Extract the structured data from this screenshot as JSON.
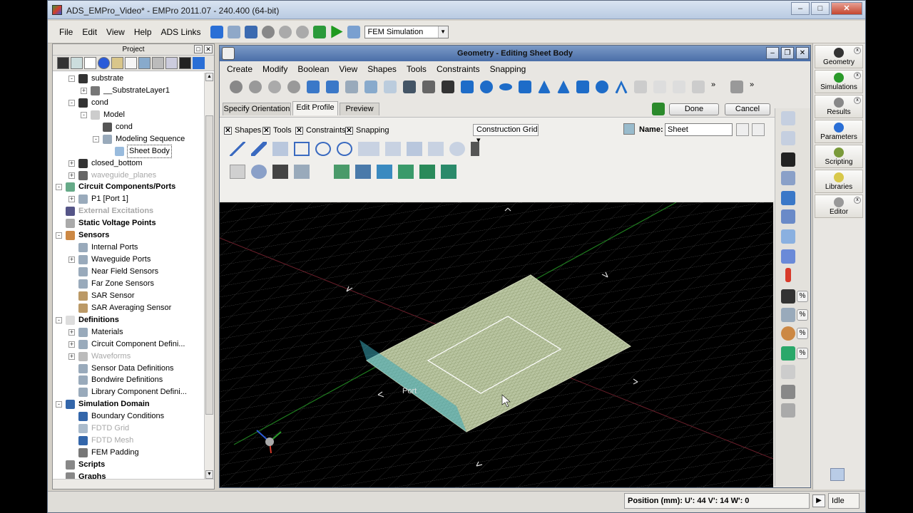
{
  "window": {
    "title": "ADS_EMPro_Video* - EMPro 2011.07 - 240.400 (64-bit)"
  },
  "menubar": {
    "items": [
      "File",
      "Edit",
      "View",
      "Help",
      "ADS Links"
    ],
    "simulation_select": "FEM Simulation"
  },
  "project": {
    "title": "Project",
    "tree": [
      {
        "label": "substrate",
        "indent": 0,
        "exp": "-",
        "style": "normal",
        "icon": "#333"
      },
      {
        "label": "__SubstrateLayer1",
        "indent": 1,
        "exp": "+",
        "style": "normal",
        "icon": "#777"
      },
      {
        "label": "cond",
        "indent": 0,
        "exp": "-",
        "style": "normal",
        "icon": "#333"
      },
      {
        "label": "Model",
        "indent": 1,
        "exp": "-",
        "style": "normal",
        "icon": "#ccc"
      },
      {
        "label": "cond",
        "indent": 2,
        "exp": "",
        "style": "normal",
        "icon": "#555"
      },
      {
        "label": "Modeling Sequence",
        "indent": 2,
        "exp": "-",
        "style": "normal",
        "icon": "#9ab"
      },
      {
        "label": "Sheet Body",
        "indent": 3,
        "exp": "",
        "style": "sel",
        "icon": "#9bd"
      },
      {
        "label": "closed_bottom",
        "indent": 0,
        "exp": "+",
        "style": "normal",
        "icon": "#333"
      },
      {
        "label": "waveguide_planes",
        "indent": 0,
        "exp": "+",
        "style": "dim",
        "icon": "#666"
      },
      {
        "label": "Circuit Components/Ports",
        "indent": -1,
        "exp": "-",
        "style": "bold",
        "icon": "#6a8"
      },
      {
        "label": "P1 [Port 1]",
        "indent": 0,
        "exp": "+",
        "style": "normal",
        "icon": "#9ab"
      },
      {
        "label": "External Excitations",
        "indent": -1,
        "exp": "",
        "style": "dim-bold",
        "icon": "#558"
      },
      {
        "label": "Static Voltage Points",
        "indent": -1,
        "exp": "",
        "style": "bold",
        "icon": "#aaa"
      },
      {
        "label": "Sensors",
        "indent": -1,
        "exp": "-",
        "style": "bold",
        "icon": "#c84"
      },
      {
        "label": "Internal Ports",
        "indent": 0,
        "exp": "",
        "style": "normal",
        "icon": "#9ab"
      },
      {
        "label": "Waveguide Ports",
        "indent": 0,
        "exp": "+",
        "style": "normal",
        "icon": "#9ab"
      },
      {
        "label": "Near Field Sensors",
        "indent": 0,
        "exp": "",
        "style": "normal",
        "icon": "#9ab"
      },
      {
        "label": "Far Zone Sensors",
        "indent": 0,
        "exp": "",
        "style": "normal",
        "icon": "#9ab"
      },
      {
        "label": "SAR Sensor",
        "indent": 0,
        "exp": "",
        "style": "normal",
        "icon": "#b96"
      },
      {
        "label": "SAR Averaging Sensor",
        "indent": 0,
        "exp": "",
        "style": "normal",
        "icon": "#b96"
      },
      {
        "label": "Definitions",
        "indent": -1,
        "exp": "-",
        "style": "bold",
        "icon": "#ddd"
      },
      {
        "label": "Materials",
        "indent": 0,
        "exp": "+",
        "style": "normal",
        "icon": "#9ab"
      },
      {
        "label": "Circuit Component Defini...",
        "indent": 0,
        "exp": "+",
        "style": "normal",
        "icon": "#9ab"
      },
      {
        "label": "Waveforms",
        "indent": 0,
        "exp": "+",
        "style": "dim",
        "icon": "#bbb"
      },
      {
        "label": "Sensor Data Definitions",
        "indent": 0,
        "exp": "",
        "style": "normal",
        "icon": "#9ab"
      },
      {
        "label": "Bondwire Definitions",
        "indent": 0,
        "exp": "",
        "style": "normal",
        "icon": "#9ab"
      },
      {
        "label": "Library Component Defini...",
        "indent": 0,
        "exp": "",
        "style": "normal",
        "icon": "#9ab"
      },
      {
        "label": "Simulation Domain",
        "indent": -1,
        "exp": "-",
        "style": "bold",
        "icon": "#36a"
      },
      {
        "label": "Boundary Conditions",
        "indent": 0,
        "exp": "",
        "style": "normal",
        "icon": "#36a"
      },
      {
        "label": "FDTD Grid",
        "indent": 0,
        "exp": "",
        "style": "dim",
        "icon": "#abc"
      },
      {
        "label": "FDTD Mesh",
        "indent": 0,
        "exp": "",
        "style": "dim",
        "icon": "#36a"
      },
      {
        "label": "FEM Padding",
        "indent": 0,
        "exp": "",
        "style": "normal",
        "icon": "#777"
      },
      {
        "label": "Scripts",
        "indent": -1,
        "exp": "",
        "style": "bold",
        "icon": "#888"
      },
      {
        "label": "Graphs",
        "indent": -1,
        "exp": "",
        "style": "bold",
        "icon": "#888"
      }
    ]
  },
  "geometry": {
    "title": "Geometry - Editing Sheet Body",
    "menu": [
      "Create",
      "Modify",
      "Boolean",
      "View",
      "Shapes",
      "Tools",
      "Constraints",
      "Snapping"
    ],
    "tabs": [
      "Specify Orientation",
      "Edit Profile",
      "Preview"
    ],
    "done": "Done",
    "cancel": "Cancel",
    "checks": [
      "Shapes",
      "Tools",
      "Constraints",
      "Snapping"
    ],
    "grid_select": "Construction Grid",
    "name_label": "Name:",
    "name_value": "Sheet",
    "viewport_label": "Port",
    "pct": "%"
  },
  "dock": [
    "Geometry",
    "Simulations",
    "Results",
    "Parameters",
    "Scripting",
    "Libraries",
    "Editor"
  ],
  "status": {
    "position": "Position (mm):  U': 44        V': 14        W': 0",
    "state": "Idle"
  }
}
